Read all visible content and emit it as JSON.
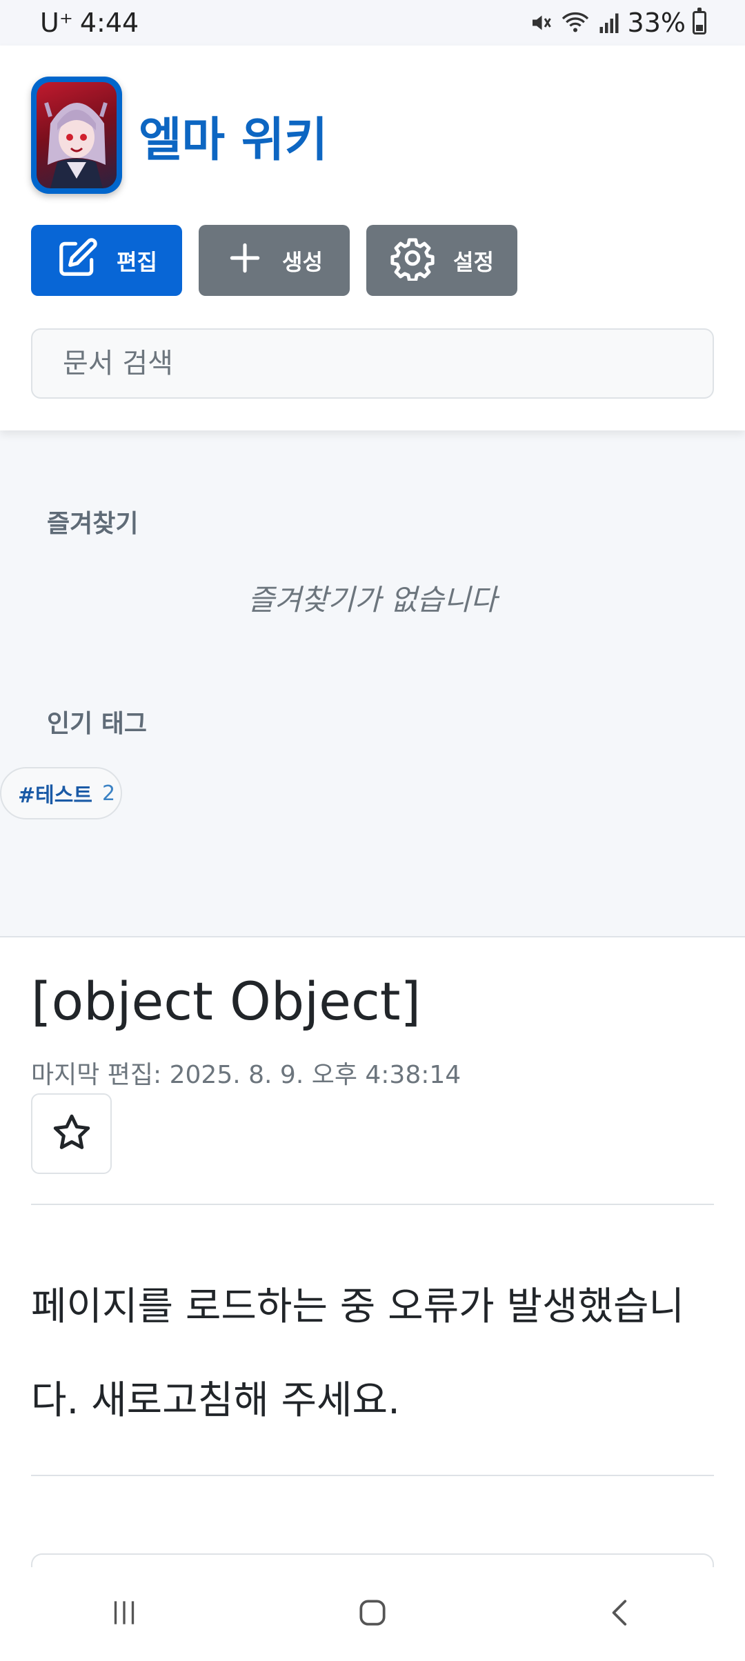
{
  "status_bar": {
    "carrier": "U⁺",
    "time": "4:44",
    "battery": "33%",
    "battery_level": 0.33
  },
  "header": {
    "title": "엘마 위키",
    "logo_icon": "app-logo-anime-character",
    "brand_color": "#0d66c2",
    "buttons": {
      "edit_label": "편집",
      "create_label": "생성",
      "settings_label": "설정"
    },
    "search": {
      "placeholder": "문서 검색",
      "value": ""
    }
  },
  "sidebar": {
    "favorites_heading": "즐겨찾기",
    "favorites_empty": "즐겨찾기가 없습니다",
    "popular_tags_heading": "인기 태그",
    "tags": [
      {
        "name": "#테스트",
        "count": "2"
      }
    ]
  },
  "document": {
    "title": "[object Object]",
    "last_edited": "마지막 편집: 2025. 8. 9. 오후 4:38:14",
    "favorite_icon": "star-outline-icon",
    "error_message": "페이지를 로드하는 중 오류가 발생했습니다. 새로고침해 주세요."
  },
  "nav_bar": {
    "recent_icon": "recent-apps-icon",
    "home_icon": "home-icon",
    "back_icon": "back-icon"
  },
  "colors": {
    "primary": "#0866d6",
    "secondary": "#6c757d",
    "sidebar_bg": "#f5f7fa"
  }
}
